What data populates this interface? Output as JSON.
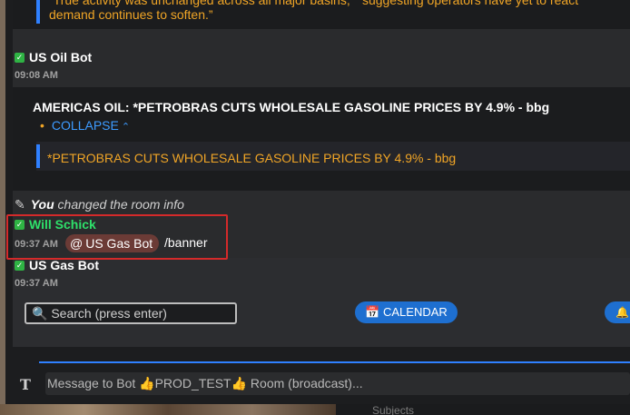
{
  "messages": {
    "top_quote_tail": "“True activity was unchanged across all major basins,” “suggesting operators have yet to react",
    "top_quote_end": "demand continues to soften.”",
    "oil_bot": {
      "sender": "US Oil Bot",
      "time": "09:08 AM",
      "headline": "AMERICAS OIL: *PETROBRAS CUTS WHOLESALE GASOLINE PRICES BY 4.9% - bbg",
      "collapse": "COLLAPSE",
      "quote": "*PETROBRAS CUTS WHOLESALE GASOLINE PRICES BY 4.9% - bbg"
    },
    "room_info": {
      "actor": "You",
      "action": "changed the room info"
    },
    "will": {
      "sender": "Will Schick",
      "time": "09:37 AM",
      "mention": "US Gas Bot",
      "command": "/banner"
    },
    "gas_bot": {
      "sender": "US Gas Bot",
      "time": "09:37 AM"
    }
  },
  "toolbar": {
    "search_placeholder": "🔍 Search (press enter)",
    "calendar_label": "📅 CALENDAR",
    "bell_label": "🔔"
  },
  "composer": {
    "placeholder": "Message to Bot 👍PROD_TEST👍 Room (broadcast)..."
  },
  "bottom": {
    "partial_label": "Subjects"
  },
  "icons": {
    "verified": "check-icon",
    "edit": "pencil-icon",
    "format": "text-format-icon"
  },
  "colors": {
    "accent_blue": "#2f80ff",
    "quote_orange": "#f0a526",
    "sender_green": "#2ee06a",
    "highlight_red": "#d42a2a"
  }
}
